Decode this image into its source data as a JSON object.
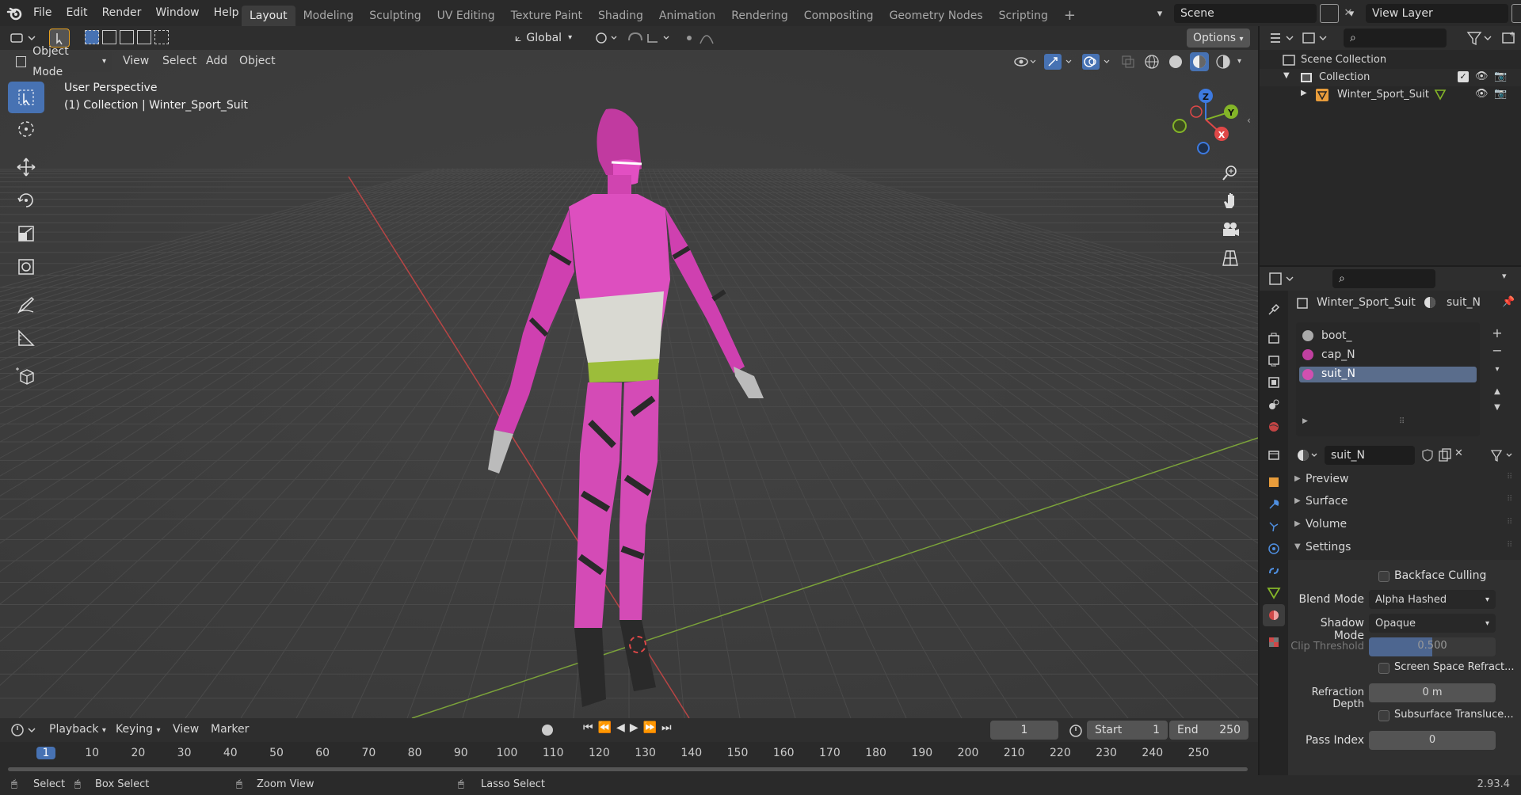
{
  "menu": [
    "File",
    "Edit",
    "Render",
    "Window",
    "Help"
  ],
  "workspaces": [
    "Layout",
    "Modeling",
    "Sculpting",
    "UV Editing",
    "Texture Paint",
    "Shading",
    "Animation",
    "Rendering",
    "Compositing",
    "Geometry Nodes",
    "Scripting"
  ],
  "active_workspace": "Layout",
  "scene": {
    "label": "Scene",
    "view_layer": "View Layer"
  },
  "header": {
    "transform_orientation": "Global",
    "options": "Options"
  },
  "viewport": {
    "mode": "Object Mode",
    "menus": [
      "View",
      "Select",
      "Add",
      "Object"
    ],
    "overlay_title": "User Perspective",
    "overlay_sub": "(1) Collection | Winter_Sport_Suit",
    "gizmo": {
      "x": "X",
      "y": "Y",
      "z": "Z"
    }
  },
  "outliner": {
    "items": [
      {
        "label": "Scene Collection"
      },
      {
        "label": "Collection"
      },
      {
        "label": "Winter_Sport_Suit"
      }
    ]
  },
  "properties": {
    "object": "Winter_Sport_Suit",
    "material": "suit_N",
    "slots": [
      "boot_",
      "cap_N",
      "suit_N"
    ],
    "selected_slot": "suit_N",
    "material_name": "suit_N",
    "panels": [
      "Preview",
      "Surface",
      "Volume",
      "Settings"
    ],
    "settings": {
      "backface_culling": "Backface Culling",
      "blend_mode_label": "Blend Mode",
      "blend_mode": "Alpha Hashed",
      "shadow_mode_label": "Shadow Mode",
      "shadow_mode": "Opaque",
      "clip_label": "Clip Threshold",
      "clip_value": "0.500",
      "clip_fraction": 0.5,
      "ssr": "Screen Space Refract...",
      "refr_depth_label": "Refraction Depth",
      "refr_depth": "0 m",
      "sst": "Subsurface Translucе...",
      "pass_index_label": "Pass Index",
      "pass_index": "0"
    }
  },
  "timeline": {
    "menus": [
      "Playback",
      "Keying",
      "View",
      "Marker"
    ],
    "current_frame": "1",
    "start_label": "Start",
    "start": "1",
    "end_label": "End",
    "end": "250",
    "ticks": [
      "1",
      "10",
      "20",
      "30",
      "40",
      "50",
      "60",
      "70",
      "80",
      "90",
      "100",
      "110",
      "120",
      "130",
      "140",
      "150",
      "160",
      "170",
      "180",
      "190",
      "200",
      "210",
      "220",
      "230",
      "240",
      "250"
    ]
  },
  "statusbar": {
    "items": [
      "Select",
      "Box Select",
      "Zoom View",
      "Lasso Select"
    ],
    "version": "2.93.4"
  },
  "colors": {
    "accent": "#4772b3",
    "suit": "#d63fb5",
    "x_axis": "#e04848",
    "y_axis": "#84b528",
    "z_axis": "#3d7ae0"
  }
}
